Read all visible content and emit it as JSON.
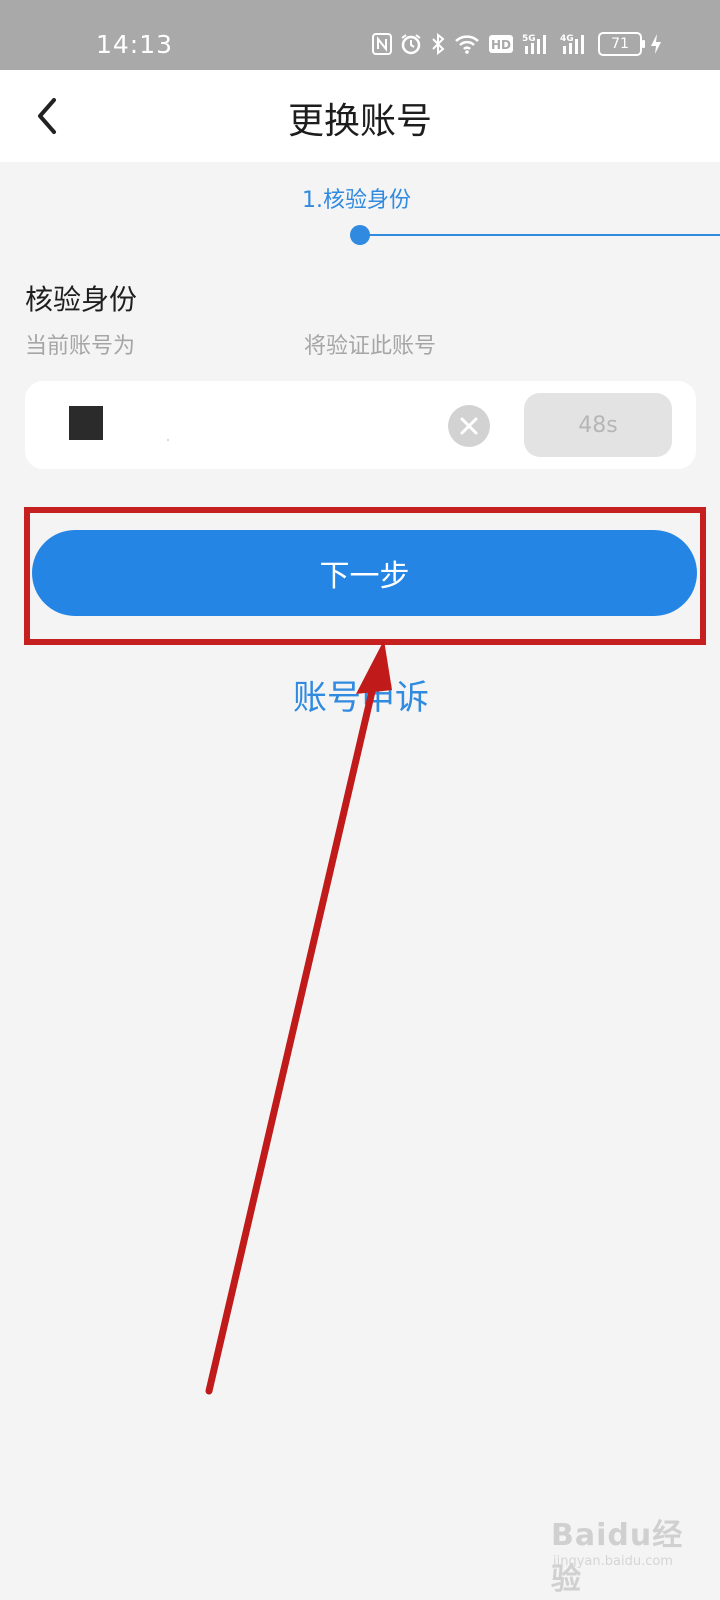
{
  "status_bar": {
    "time": "14:13",
    "network_5g": "5G",
    "network_4g": "4G",
    "hd": "HD",
    "battery_level": "71",
    "icons": [
      "nfc-icon",
      "alarm-icon",
      "bluetooth-icon",
      "wifi-icon",
      "hd-icon",
      "signal-5g-icon",
      "signal-4g-icon",
      "battery-icon",
      "charging-icon"
    ]
  },
  "header": {
    "title": "更换账号",
    "back_icon": "chevron-left-icon"
  },
  "steps": {
    "current_label": "1.核验身份"
  },
  "verify": {
    "section_title": "核验身份",
    "current_account_label": "当前账号为",
    "will_verify_label": "将验证此账号",
    "countdown": "48s"
  },
  "actions": {
    "next_label": "下一步",
    "appeal_label": "账号申诉"
  },
  "watermark": {
    "text": "Baidu经验",
    "sub": "jingyan.baidu.com"
  },
  "colors": {
    "accent": "#2585e4",
    "link": "#2f8ae0",
    "annotation": "#c51f1f",
    "status_bar": "#a9a9a9",
    "background": "#f4f4f4"
  }
}
